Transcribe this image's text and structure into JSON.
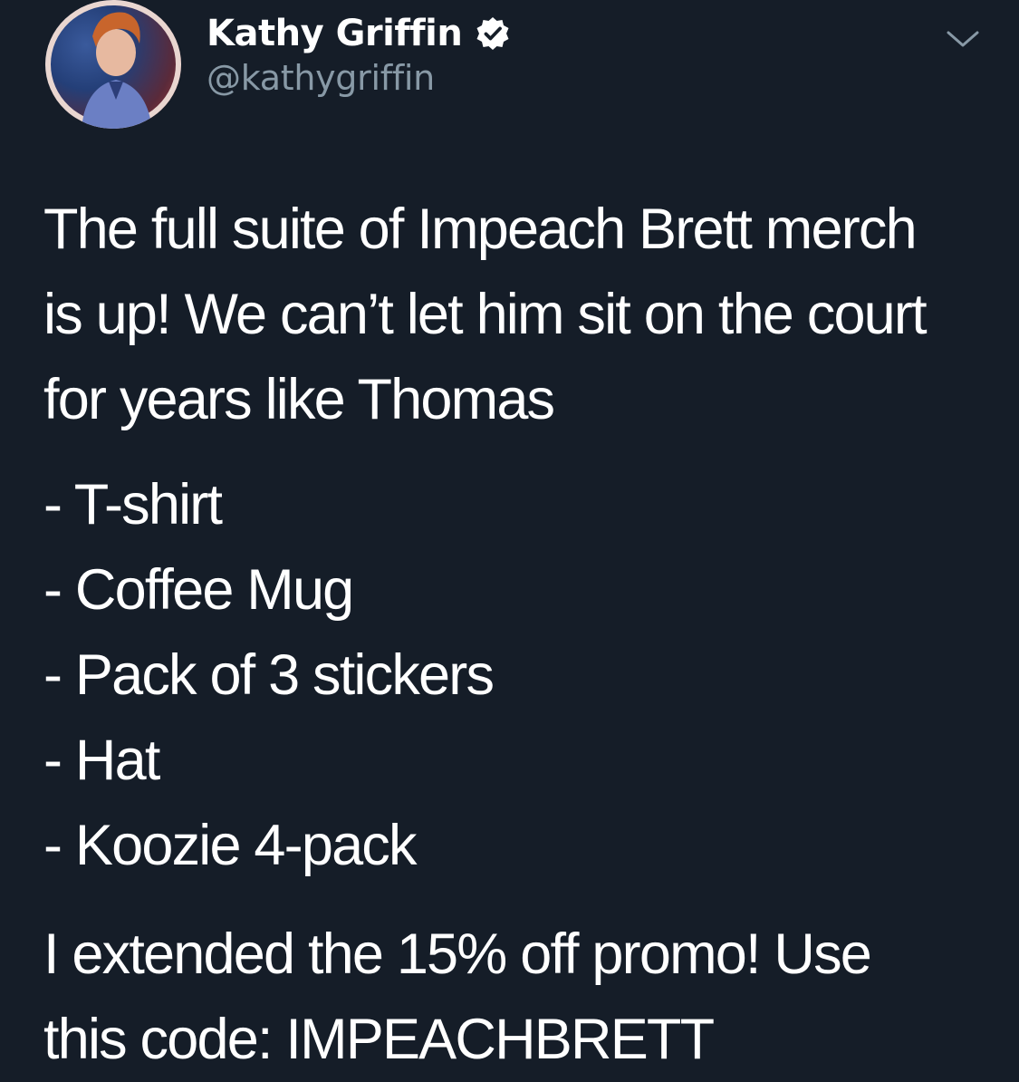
{
  "author": {
    "display_name": "Kathy Griffin",
    "handle": "@kathygriffin",
    "verified": true,
    "avatar_icon": "profile-photo"
  },
  "menu": {
    "icon": "chevron-down-icon"
  },
  "tweet": {
    "intro_lines": [
      "The full suite of Impeach Brett merch",
      "is up! We can’t let him sit on the court",
      "for years like Thomas"
    ],
    "items": [
      "- T-shirt",
      "- Coffee Mug",
      "- Pack of 3 stickers",
      "- Hat",
      "- Koozie 4-pack"
    ],
    "promo_lines": [
      "I extended the 15% off promo! Use",
      "this code: IMPEACHBRETT"
    ]
  },
  "colors": {
    "background": "#151d28",
    "text": "#ffffff",
    "secondary_text": "#8899a6",
    "verified_badge": "#ffffff"
  }
}
